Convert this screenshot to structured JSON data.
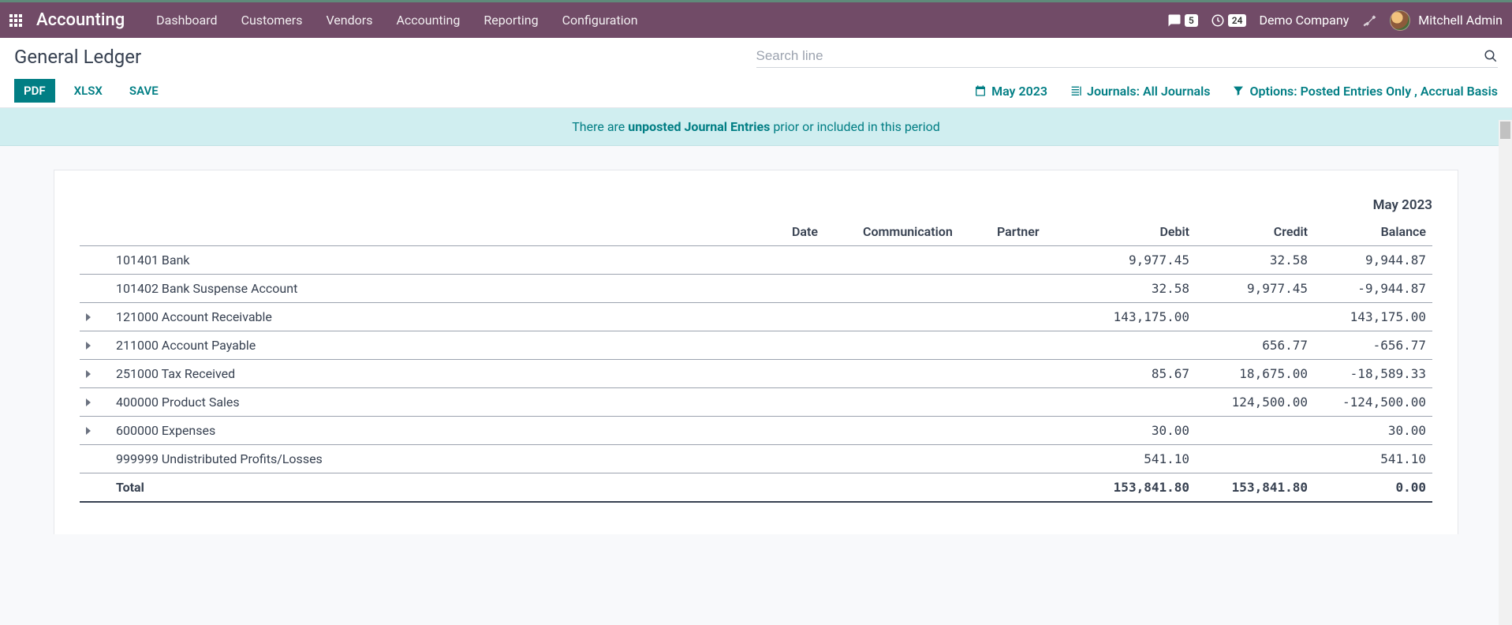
{
  "topbar": {
    "brand": "Accounting",
    "menu": [
      "Dashboard",
      "Customers",
      "Vendors",
      "Accounting",
      "Reporting",
      "Configuration"
    ],
    "chat_count": "5",
    "clock_count": "24",
    "company": "Demo Company",
    "username": "Mitchell Admin"
  },
  "header": {
    "page_title": "General Ledger",
    "search_placeholder": "Search line",
    "pdf_label": "PDF",
    "xlsx_label": "XLSX",
    "save_label": "SAVE",
    "period_filter": "May 2023",
    "journals_filter": "Journals: All Journals",
    "options_filter": "Options: Posted Entries Only , Accrual Basis"
  },
  "banner": {
    "prefix": "There are ",
    "strong": "unposted Journal Entries",
    "suffix": " prior or included in this period"
  },
  "report": {
    "period_title": "May 2023",
    "columns": {
      "date": "Date",
      "communication": "Communication",
      "partner": "Partner",
      "debit": "Debit",
      "credit": "Credit",
      "balance": "Balance"
    },
    "rows": [
      {
        "expandable": false,
        "name": "101401 Bank",
        "debit": "9,977.45",
        "credit": "32.58",
        "balance": "9,944.87",
        "neg": false
      },
      {
        "expandable": false,
        "name": "101402 Bank Suspense Account",
        "debit": "32.58",
        "credit": "9,977.45",
        "balance": "-9,944.87",
        "neg": true
      },
      {
        "expandable": true,
        "name": "121000 Account Receivable",
        "debit": "143,175.00",
        "credit": "",
        "balance": "143,175.00",
        "neg": false
      },
      {
        "expandable": true,
        "name": "211000 Account Payable",
        "debit": "",
        "credit": "656.77",
        "balance": "-656.77",
        "neg": true
      },
      {
        "expandable": true,
        "name": "251000 Tax Received",
        "debit": "85.67",
        "credit": "18,675.00",
        "balance": "-18,589.33",
        "neg": true
      },
      {
        "expandable": true,
        "name": "400000 Product Sales",
        "debit": "",
        "credit": "124,500.00",
        "balance": "-124,500.00",
        "neg": true
      },
      {
        "expandable": true,
        "name": "600000 Expenses",
        "debit": "30.00",
        "credit": "",
        "balance": "30.00",
        "neg": false
      },
      {
        "expandable": false,
        "name": "999999 Undistributed Profits/Losses",
        "debit": "541.10",
        "credit": "",
        "balance": "541.10",
        "neg": false
      }
    ],
    "total": {
      "label": "Total",
      "debit": "153,841.80",
      "credit": "153,841.80",
      "balance": "0.00"
    }
  }
}
